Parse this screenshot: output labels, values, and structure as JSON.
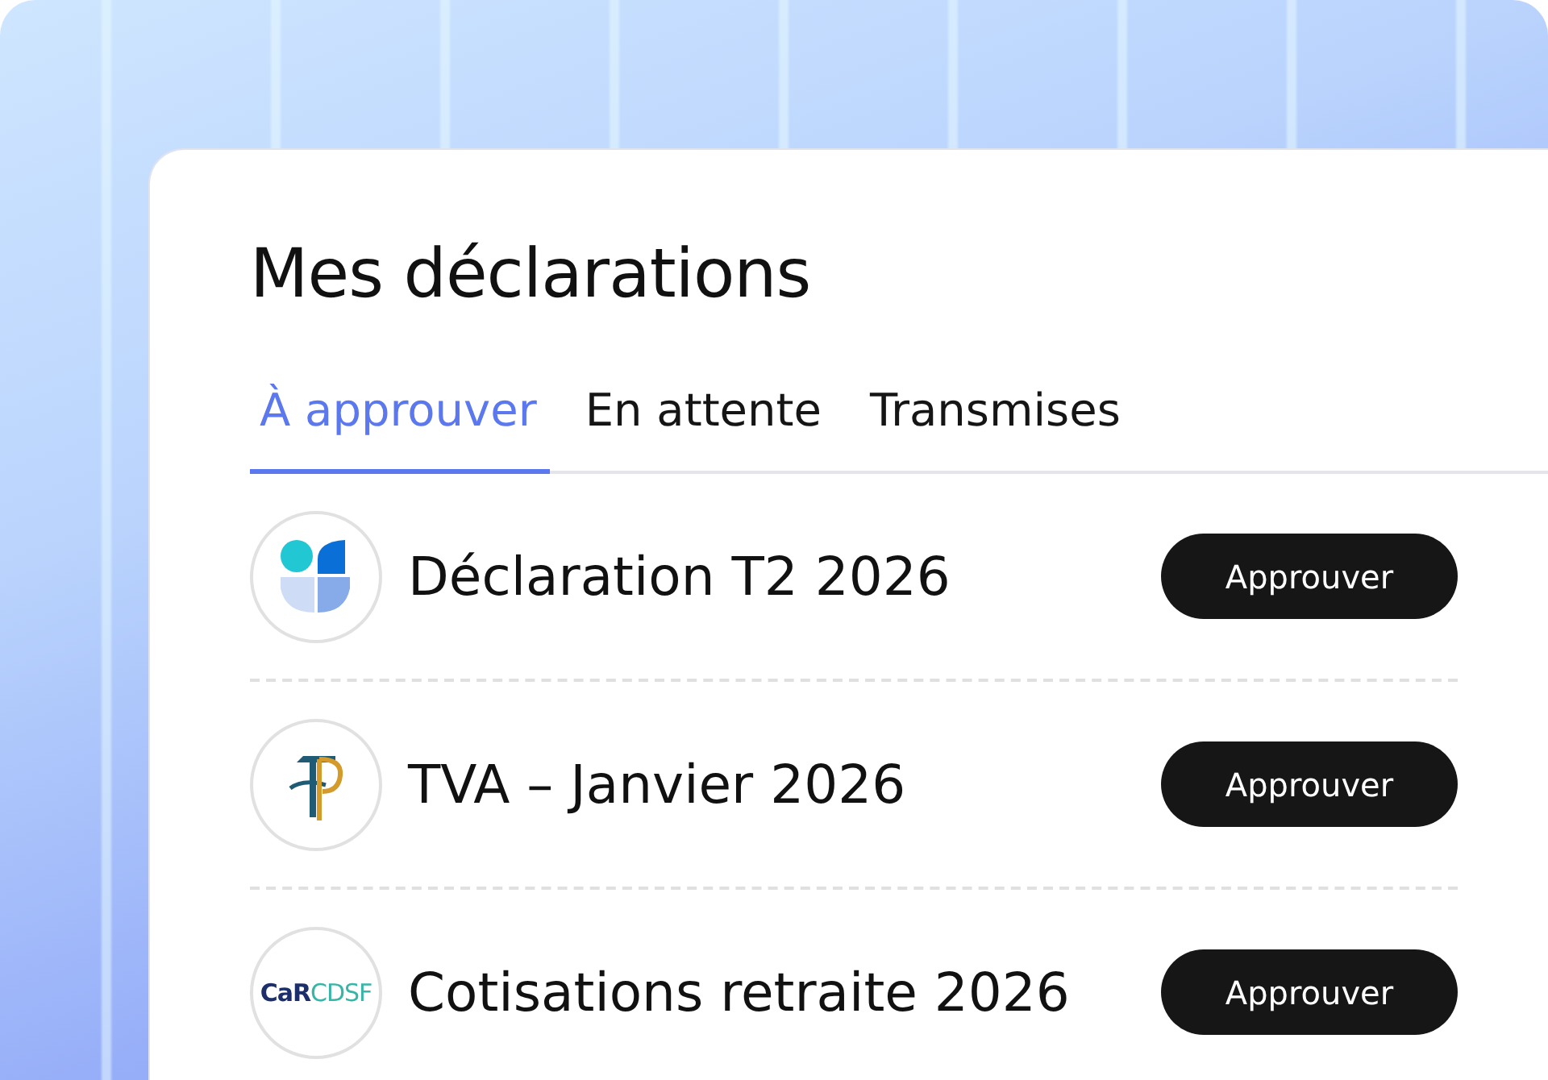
{
  "title": "Mes déclarations",
  "tabs": [
    {
      "label": "À approuver",
      "selected": true
    },
    {
      "label": "En attente",
      "selected": false
    },
    {
      "label": "Transmises",
      "selected": false
    }
  ],
  "declarations": [
    {
      "name": "Déclaration T2 2026",
      "logo": {
        "kind": "segments"
      },
      "button": "Approuver"
    },
    {
      "name": "TVA – Janvier 2026",
      "logo": {
        "kind": "monogram"
      },
      "button": "Approuver"
    },
    {
      "name": "Cotisations retraite 2026",
      "logo": {
        "kind": "wordmark",
        "text": "CaR",
        "text_2": "CDSF"
      },
      "button": "Approuver"
    }
  ]
}
